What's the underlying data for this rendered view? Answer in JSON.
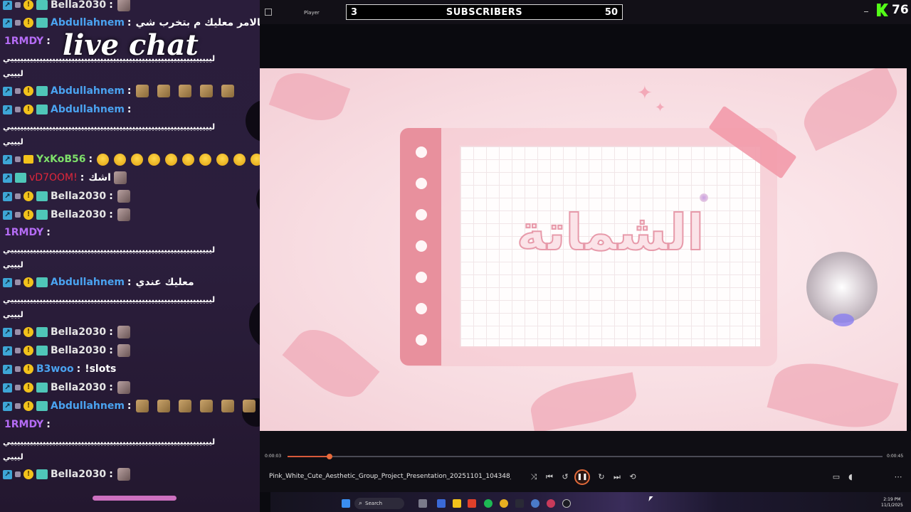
{
  "chat": {
    "title": "live chat",
    "messages": [
      {
        "user": "Bella2030",
        "color": "#e6e6e6",
        "text": "",
        "top": 0
      },
      {
        "user": "Abdullahnem",
        "color": "#4aa3f0",
        "text": "بالامر معليك م بتخرب شي"
      },
      {
        "user": "1RMDY",
        "color": "#b56cf5",
        "text": ""
      },
      {
        "user": "Abdullahnem",
        "color": "#4aa3f0",
        "text": ""
      },
      {
        "user": "Abdullahnem",
        "color": "#4aa3f0",
        "text": ""
      },
      {
        "user": "YxKoB56",
        "color": "#7ee06a",
        "text": ""
      },
      {
        "user": "vD7OOM!",
        "color": "#e0263a",
        "text": "اشك"
      },
      {
        "user": "Bella2030",
        "color": "#e6e6e6",
        "text": ""
      },
      {
        "user": "Bella2030",
        "color": "#e6e6e6",
        "text": ""
      },
      {
        "user": "1RMDY",
        "color": "#b56cf5",
        "text": ""
      },
      {
        "user": "Abdullahnem",
        "color": "#4aa3f0",
        "text": "معليك عندي"
      },
      {
        "user": "Bella2030",
        "color": "#e6e6e6",
        "text": ""
      },
      {
        "user": "Bella2030",
        "color": "#e6e6e6",
        "text": ""
      },
      {
        "user": "B3woo",
        "color": "#4aa3f0",
        "text": "!slots"
      },
      {
        "user": "Bella2030",
        "color": "#e6e6e6",
        "text": ""
      },
      {
        "user": "Abdullahnem",
        "color": "#4aa3f0",
        "text": ""
      },
      {
        "user": "1RMDY",
        "color": "#b56cf5",
        "text": ""
      },
      {
        "user": "Bella2030",
        "color": "#e6e6e6",
        "text": ""
      }
    ],
    "spam_line": "ليييييييييييييييييييييييييييييييييييييييييييييييييييييييييييييييي",
    "spam_tail": "ليييي"
  },
  "titlebar": {
    "player_label": "Player"
  },
  "subscribers": {
    "current": "3",
    "label": "SUBSCRIBERS",
    "goal": "50"
  },
  "kick": {
    "viewers": "76",
    "color": "#53fc18"
  },
  "slide": {
    "title": "الشماتة"
  },
  "player": {
    "time_current": "0:00:03",
    "time_total": "0:00:45",
    "progress": 0.07,
    "file_name": "Pink_White_Cute_Aesthetic_Group_Project_Presentation_20251101_104348_"
  },
  "taskbar": {
    "search_label": "Search",
    "time": "2:19 PM",
    "date": "11/1/2025"
  }
}
